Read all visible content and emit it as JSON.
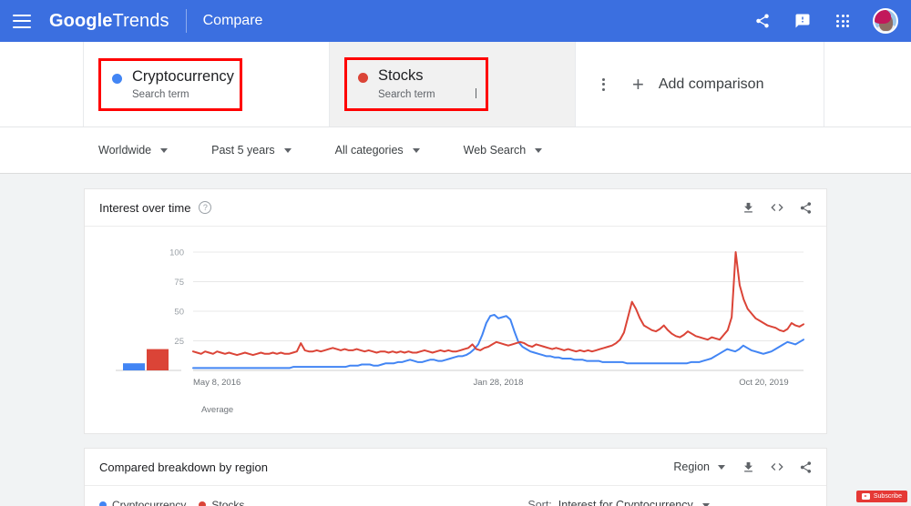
{
  "appbar": {
    "menu_icon": "hamburger-icon",
    "brand_google": "Google",
    "brand_trends": "Trends",
    "section": "Compare",
    "icons": [
      "share-icon",
      "feedback-icon",
      "apps-grid-icon",
      "avatar"
    ]
  },
  "terms": [
    {
      "label": "Cryptocurrency",
      "sublabel": "Search term",
      "color": "#4285F4",
      "highlighted": true
    },
    {
      "label": "Stocks",
      "sublabel": "Search term",
      "color": "#DB4437",
      "highlighted": true,
      "hovered": true
    }
  ],
  "term_menu_icon": "more-vert-icon",
  "add_comparison": {
    "plus": "+",
    "label": "Add comparison"
  },
  "filters": [
    {
      "label": "Worldwide"
    },
    {
      "label": "Past 5 years"
    },
    {
      "label": "All categories"
    },
    {
      "label": "Web Search"
    }
  ],
  "interest_card": {
    "title": "Interest over time",
    "help_glyph": "?",
    "actions": [
      "download-icon",
      "embed-icon",
      "share-icon"
    ],
    "average_label": "Average"
  },
  "region_card": {
    "title": "Compared breakdown by region",
    "region_select": "Region",
    "actions": [
      "download-icon",
      "embed-icon",
      "share-icon"
    ],
    "legend": [
      {
        "label": "Cryptocurrency",
        "color": "#4285F4"
      },
      {
        "label": "Stocks",
        "color": "#DB4437"
      }
    ],
    "sort_label": "Sort:",
    "sort_value": "Interest for Cryptocurrency"
  },
  "youtube_overlay": {
    "label": "Subscribe"
  },
  "colors": {
    "brand_blue": "#3b6fe0",
    "series_crypto": "#4285F4",
    "series_stocks": "#DB4437",
    "highlight_box": "#ff0000"
  },
  "chart_data": {
    "type": "line",
    "title": "Interest over time",
    "xlabel": "",
    "ylabel": "",
    "ylim": [
      0,
      100
    ],
    "yticks": [
      25,
      50,
      75,
      100
    ],
    "grid": true,
    "legend": "none",
    "xtick_labels": [
      "May 8, 2016",
      "Jan 28, 2018",
      "Oct 20, 2019"
    ],
    "xtick_positions": [
      0,
      0.5,
      0.935
    ],
    "series": [
      {
        "name": "Cryptocurrency",
        "color": "#4285F4",
        "values": [
          2,
          2,
          2,
          2,
          2,
          2,
          2,
          2,
          2,
          2,
          2,
          2,
          2,
          2,
          2,
          2,
          2,
          2,
          2,
          2,
          2,
          2,
          2,
          2,
          2,
          3,
          3,
          3,
          3,
          3,
          3,
          3,
          3,
          3,
          3,
          3,
          3,
          3,
          3,
          4,
          4,
          4,
          5,
          5,
          5,
          4,
          4,
          5,
          6,
          6,
          6,
          7,
          7,
          8,
          9,
          8,
          7,
          7,
          8,
          9,
          9,
          8,
          8,
          9,
          10,
          11,
          12,
          12,
          13,
          15,
          18,
          22,
          30,
          40,
          46,
          47,
          44,
          45,
          46,
          43,
          33,
          24,
          20,
          18,
          16,
          15,
          14,
          13,
          12,
          12,
          11,
          11,
          10,
          10,
          10,
          9,
          9,
          9,
          8,
          8,
          8,
          8,
          7,
          7,
          7,
          7,
          7,
          7,
          6,
          6,
          6,
          6,
          6,
          6,
          6,
          6,
          6,
          6,
          6,
          6,
          6,
          6,
          6,
          6,
          7,
          7,
          7,
          8,
          9,
          10,
          12,
          14,
          16,
          18,
          17,
          16,
          18,
          21,
          19,
          17,
          16,
          15,
          14,
          15,
          16,
          18,
          20,
          22,
          24,
          23,
          22,
          24,
          26
        ],
        "average": 6
      },
      {
        "name": "Stocks",
        "color": "#DB4437",
        "values": [
          16,
          15,
          14,
          16,
          15,
          14,
          16,
          15,
          14,
          15,
          14,
          13,
          14,
          15,
          14,
          13,
          14,
          15,
          14,
          14,
          15,
          14,
          15,
          14,
          14,
          15,
          16,
          23,
          17,
          16,
          16,
          17,
          16,
          17,
          18,
          19,
          18,
          17,
          18,
          17,
          17,
          18,
          17,
          16,
          17,
          16,
          15,
          16,
          16,
          15,
          16,
          15,
          16,
          15,
          16,
          15,
          15,
          16,
          17,
          16,
          15,
          16,
          17,
          16,
          17,
          16,
          16,
          17,
          18,
          19,
          22,
          18,
          17,
          19,
          20,
          22,
          24,
          23,
          22,
          21,
          22,
          23,
          24,
          23,
          21,
          20,
          22,
          21,
          20,
          19,
          18,
          19,
          18,
          17,
          18,
          17,
          16,
          17,
          16,
          17,
          16,
          17,
          18,
          19,
          20,
          21,
          23,
          26,
          32,
          45,
          58,
          52,
          44,
          38,
          36,
          34,
          33,
          35,
          38,
          34,
          31,
          29,
          28,
          30,
          33,
          31,
          29,
          28,
          27,
          26,
          28,
          27,
          26,
          30,
          34,
          45,
          100,
          72,
          60,
          52,
          48,
          44,
          42,
          40,
          38,
          37,
          36,
          34,
          33,
          35,
          40,
          38,
          37,
          39
        ],
        "average": 18
      }
    ],
    "average_bars": {
      "label": "Average",
      "values": [
        {
          "name": "Cryptocurrency",
          "value": 6,
          "color": "#4285F4"
        },
        {
          "name": "Stocks",
          "value": 18,
          "color": "#DB4437"
        }
      ]
    }
  }
}
